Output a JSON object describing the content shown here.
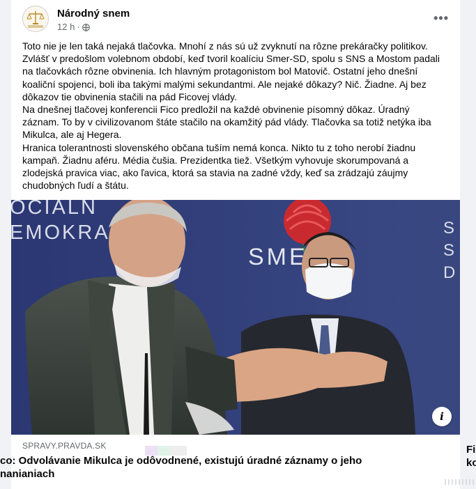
{
  "post": {
    "page_name": "Národný snem",
    "timestamp": "12 h",
    "separator": "·",
    "more_label": "•••",
    "paragraphs": [
      "Toto nie je len taká nejaká tlačovka. Mnohí z nás sú už zvyknutí na rôzne prekáračky politikov. Zvlášť v predošlom volebnom období, keď tvoril koalíciu Smer-SD, spolu s SNS a Mostom padali na tlačovkách rôzne obvinenia. Ich hlavným protagonistom bol Matovič. Ostatní jeho dnešní koaliční spojenci, boli iba takými malými sekundantmi. Ale nejaké dôkazy? Nič. Žiadne. Aj bez dôkazov tie obvinenia stačili na pád Ficovej vlády.",
      "Na dnešnej tlačovej konferencii Fico predložil na každé obvinenie písomný dôkaz. Úradný záznam. To by v civilizovanom štáte stačilo na okamžitý pád vlády. Tlačovka sa totiž netýka iba Mikulca, ale aj Hegera.",
      "Hranica tolerantnosti slovenského občana tuším nemá konca. Nikto tu z toho nerobí žiadnu kampaň. Žiadnu aféru. Média čušia. Prezidentka tiež. Všetkým vyhovuje skorumpovaná a zlodejská pravica viac, ako ľavica, ktorá sa stavia na zadné vždy, keď sa zrádzajú záujmy chudobných ľudí a štátu."
    ]
  },
  "photo": {
    "backdrop_left_lines": [
      "OCIÁLN",
      "EMOKRA"
    ],
    "backdrop_logo": "SMER",
    "backdrop_right_letters": [
      "S",
      "S",
      "D"
    ],
    "info_label": "i"
  },
  "link": {
    "domain": "SPRAVY.PRAVDA.SK",
    "title": "co: Odvolávanie Mikulca je odôvodnené, existujú úradné záznamy o jeho nanianiach",
    "side_text": "Fi\nko"
  },
  "colors": {
    "backdrop_blue": "#2c3a73",
    "smer_red": "#d8232a",
    "text_primary": "#050505",
    "text_secondary": "#65676b"
  }
}
